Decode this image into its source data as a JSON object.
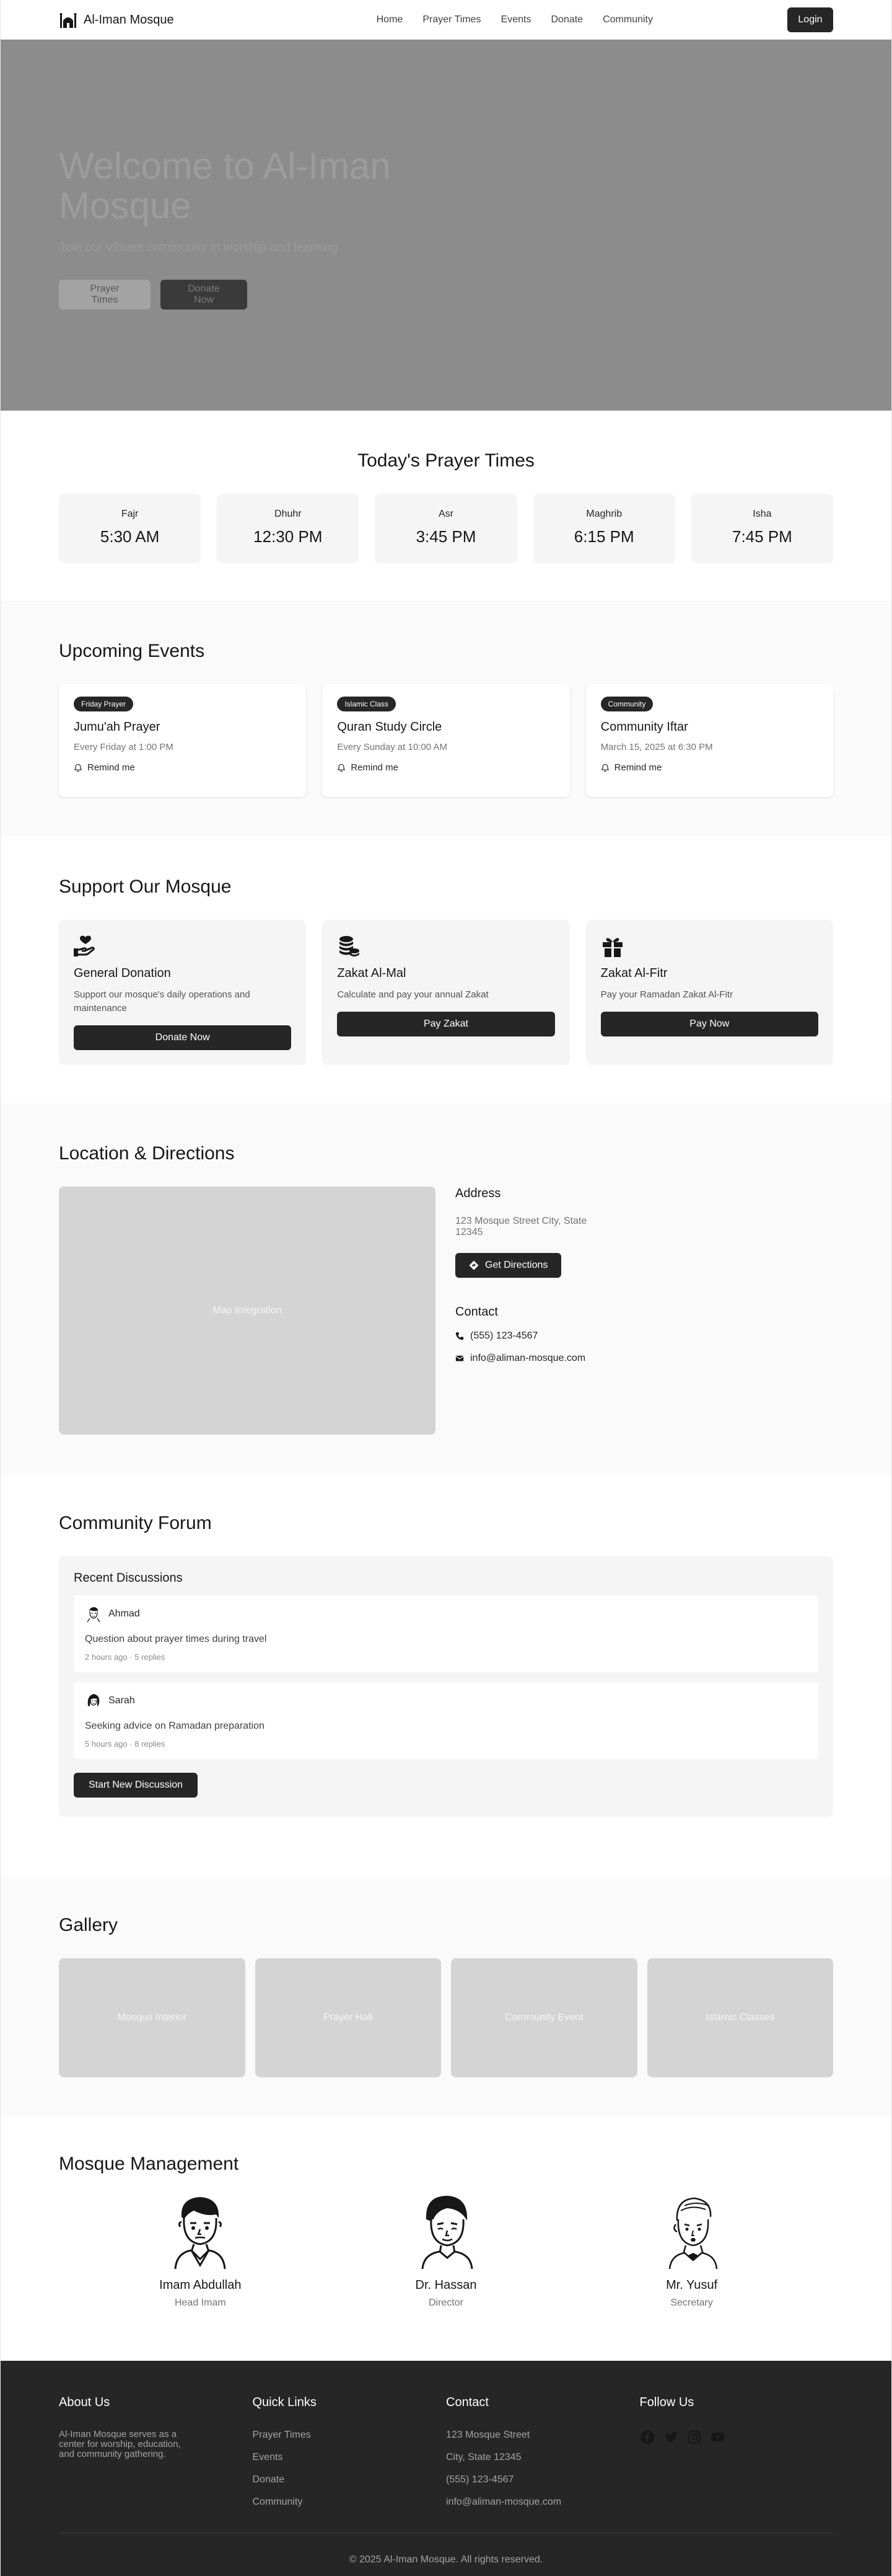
{
  "nav": {
    "brand": "Al-Iman Mosque",
    "links": [
      "Home",
      "Prayer Times",
      "Events",
      "Donate",
      "Community"
    ],
    "login": "Login"
  },
  "hero": {
    "title": "Welcome to Al-Iman Mosque",
    "subtitle": "Join our vibrant community in worship and learning",
    "btn_prayer": "Prayer Times",
    "btn_donate": "Donate Now"
  },
  "prayer": {
    "title": "Today's Prayer Times",
    "times": [
      {
        "name": "Fajr",
        "time": "5:30 AM"
      },
      {
        "name": "Dhuhr",
        "time": "12:30 PM"
      },
      {
        "name": "Asr",
        "time": "3:45 PM"
      },
      {
        "name": "Maghrib",
        "time": "6:15 PM"
      },
      {
        "name": "Isha",
        "time": "7:45 PM"
      }
    ]
  },
  "events": {
    "title": "Upcoming Events",
    "items": [
      {
        "badge": "Friday Prayer",
        "title": "Jumu'ah Prayer",
        "date": "Every Friday at 1:00 PM",
        "remind": "Remind me"
      },
      {
        "badge": "Islamic Class",
        "title": "Quran Study Circle",
        "date": "Every Sunday at 10:00 AM",
        "remind": "Remind me"
      },
      {
        "badge": "Community",
        "title": "Community Iftar",
        "date": "March 15, 2025 at 6:30 PM",
        "remind": "Remind me"
      }
    ]
  },
  "support": {
    "title": "Support Our Mosque",
    "items": [
      {
        "icon": "hand-heart-icon",
        "title": "General Donation",
        "desc": "Support our mosque's daily operations and maintenance",
        "button": "Donate Now"
      },
      {
        "icon": "coins-icon",
        "title": "Zakat Al-Mal",
        "desc": "Calculate and pay your annual Zakat",
        "button": "Pay Zakat"
      },
      {
        "icon": "gift-icon",
        "title": "Zakat Al-Fitr",
        "desc": "Pay your Ramadan Zakat Al-Fitr",
        "button": "Pay Now"
      }
    ]
  },
  "location": {
    "title": "Location & Directions",
    "map_label": "Map Integration",
    "address_title": "Address",
    "address": "123 Mosque Street City, State 12345",
    "directions": "Get Directions",
    "contact_title": "Contact",
    "phone": "(555) 123-4567",
    "email": "info@aliman-mosque.com"
  },
  "forum": {
    "title": "Community Forum",
    "subtitle": "Recent Discussions",
    "threads": [
      {
        "user": "Ahmad",
        "question": "Question about prayer times during travel",
        "meta": "2 hours ago · 5 replies"
      },
      {
        "user": "Sarah",
        "question": "Seeking advice on Ramadan preparation",
        "meta": "5 hours ago · 8 replies"
      }
    ],
    "start": "Start New Discussion"
  },
  "gallery": {
    "title": "Gallery",
    "items": [
      "Mosque Interior",
      "Prayer Hall",
      "Community Event",
      "Islamic Classes"
    ]
  },
  "management": {
    "title": "Mosque Management",
    "members": [
      {
        "name": "Imam Abdullah",
        "role": "Head Imam"
      },
      {
        "name": "Dr. Hassan",
        "role": "Director"
      },
      {
        "name": "Mr. Yusuf",
        "role": "Secretary"
      }
    ]
  },
  "footer": {
    "about_title": "About Us",
    "about_text": "Al-Iman Mosque serves as a center for worship, education, and community gathering.",
    "links_title": "Quick Links",
    "links": [
      "Prayer Times",
      "Events",
      "Donate",
      "Community"
    ],
    "contact_title": "Contact",
    "contact": [
      "123 Mosque Street",
      "City, State 12345",
      "(555) 123-4567",
      "info@aliman-mosque.com"
    ],
    "follow_title": "Follow Us",
    "socials": [
      "facebook-icon",
      "twitter-icon",
      "instagram-icon",
      "youtube-icon"
    ],
    "copyright": "© 2025 Al-Iman Mosque. All rights reserved."
  }
}
